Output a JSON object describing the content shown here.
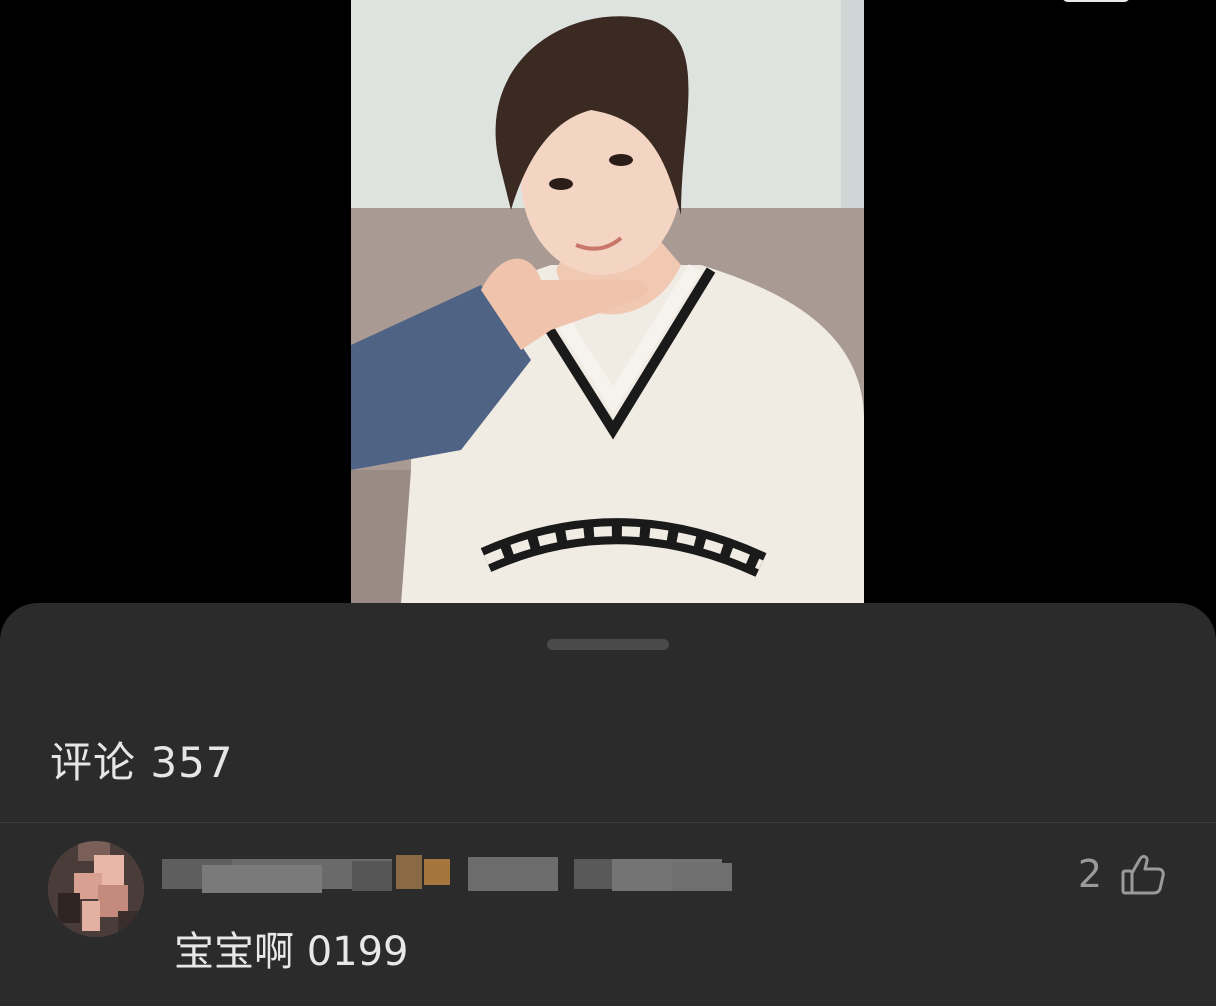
{
  "comments_panel": {
    "title": "评论 357"
  },
  "comment": {
    "text": "宝宝啊 0199",
    "like_count": "2",
    "like_icon": "thumbs-up-icon"
  },
  "colors": {
    "sheet_bg": "#2b2b2b",
    "text_primary": "#e8e8e8",
    "text_secondary": "#9a9a9a"
  }
}
